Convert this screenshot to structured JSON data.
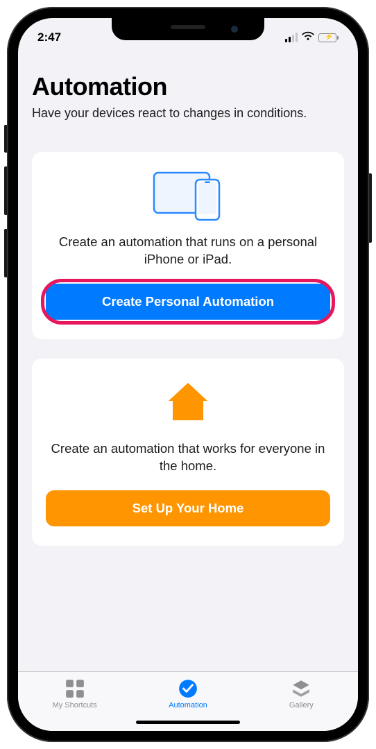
{
  "statusbar": {
    "time": "2:47"
  },
  "header": {
    "title": "Automation",
    "subtitle": "Have your devices react to changes in conditions."
  },
  "cards": {
    "personal": {
      "description": "Create an automation that runs on a personal iPhone or iPad.",
      "button_label": "Create Personal Automation"
    },
    "home": {
      "description": "Create an automation that works for everyone in the home.",
      "button_label": "Set Up Your Home"
    }
  },
  "tabs": {
    "shortcuts": {
      "label": "My Shortcuts"
    },
    "automation": {
      "label": "Automation"
    },
    "gallery": {
      "label": "Gallery"
    }
  },
  "colors": {
    "blue": "#007aff",
    "orange": "#ff9500",
    "highlight": "#e6175c",
    "green": "#34c759"
  }
}
